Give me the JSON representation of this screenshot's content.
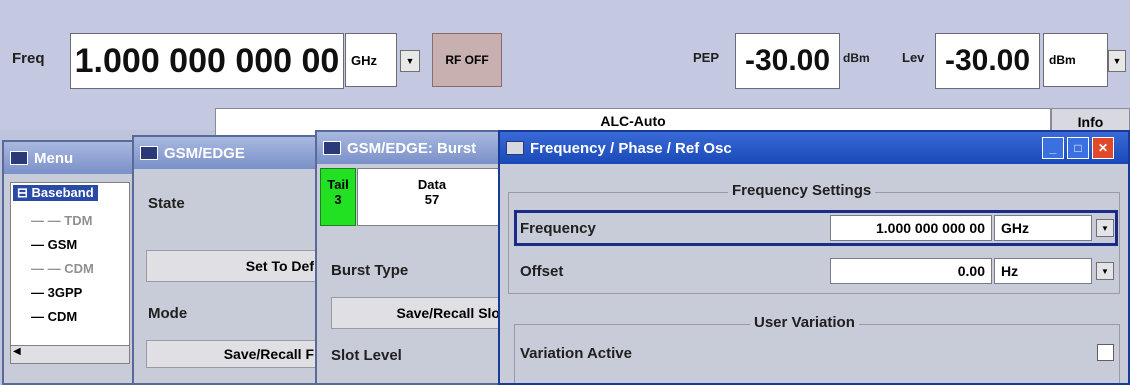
{
  "top": {
    "freq_label": "Freq",
    "freq_value": "1.000 000 000 00",
    "freq_unit": "GHz",
    "rf_button": "RF OFF",
    "pep_label": "PEP",
    "pep_value": "-30.00",
    "pep_unit": "dBm",
    "lev_label": "Lev",
    "lev_value": "-30.00",
    "lev_unit": "dBm",
    "alc_status": "ALC-Auto",
    "info_button": "Info"
  },
  "menu_window": {
    "title": "Menu",
    "tree": [
      "Baseband",
      "TDM",
      "GSM",
      "CDM",
      "3GPP",
      "CDM"
    ]
  },
  "gsm_window": {
    "title": "GSM/EDGE",
    "state_label": "State",
    "set_default_button": "Set To Def",
    "mode_label": "Mode",
    "save_recall_button": "Save/Recall F"
  },
  "burst_window": {
    "title": "GSM/EDGE: Burst",
    "tail_label": "Tail",
    "tail_value": "3",
    "data_label": "Data",
    "data_value": "57",
    "burst_type_label": "Burst Type",
    "save_recall_slot_button": "Save/Recall Slo",
    "slot_level_label": "Slot Level"
  },
  "freq_window": {
    "title": "Frequency / Phase / Ref Osc",
    "group_title": "Frequency Settings",
    "frequency_label": "Frequency",
    "frequency_value": "1.000 000 000 00",
    "frequency_unit": "GHz",
    "offset_label": "Offset",
    "offset_value": "0.00",
    "offset_unit": "Hz",
    "user_variation_title": "User Variation",
    "variation_active_label": "Variation Active"
  },
  "colors": {
    "accent": "#1a48b8",
    "tail_highlight": "#22e022",
    "close_button": "#e04a2a"
  }
}
